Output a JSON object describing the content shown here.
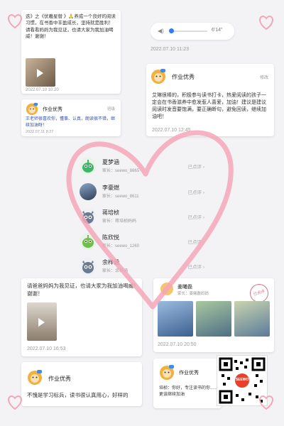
{
  "colors": {
    "accent": "#2f7cf6",
    "heart": "#f4a6b8",
    "card": "#ffffff",
    "muted": "#999999"
  },
  "top_left_post": {
    "text": "迭》之《伏羲星替 》🙏养成一个良好的阅读习惯，在书香中丰盈成长，坚持就是胜利！请看看妈妈为我见证，也请大家为我加油喝威！谢谢！",
    "timestamp": "2022.07.10 10:20"
  },
  "top_right_audio": {
    "duration": "6'14\"",
    "timestamp": "2022.07.10 11:23"
  },
  "left_excellent_card": {
    "title": "作业优秀",
    "badge": "班级",
    "text": "王老师很喜欢你，懂事、认真，朗读很不错，继续加油呀！",
    "timestamp": "2022.07.11 8:27"
  },
  "right_excellent_card": {
    "title": "作业优秀",
    "corner": "修改",
    "text": "艾琳很棒的，积极参与读书打卡，热爱阅读的孩子一定会在书香滋养中愈发惹人喜爱，加油！建议是建议阅读时发音要饱满，要正确断句，避免回读，继续加油吧！",
    "timestamp": "2022.07.10 12:45"
  },
  "students": [
    {
      "name": "夏梦涵",
      "parent": "家长：seewo_8865",
      "status": "已点评 ›",
      "avatar": "green-robot"
    },
    {
      "name": "李豪燃",
      "parent": "家长：seewo_8611",
      "status": "已点评 ›",
      "avatar": "photo"
    },
    {
      "name": "蒋培桢",
      "parent": "家长：蒋培桢妈妈",
      "status": "已点评 ›",
      "avatar": "grey-owl"
    },
    {
      "name": "陈欣悦",
      "parent": "家长：seewo_1260",
      "status": "已点评 ›",
      "avatar": "green-robot"
    },
    {
      "name": "余梓涵",
      "parent": "家长：余梓涵",
      "status": "已点评 ›",
      "avatar": "grey-owl"
    }
  ],
  "bottom_left_post": {
    "text": "请爸爸妈妈为我见证，也请大家为我加油喝威！谢谢！",
    "timestamp": "2022.07.10 16:53"
  },
  "bottom_right_post": {
    "name": "姜曦磊",
    "parent": "家长：姜曦磊妈妈",
    "timestamp": "2022.07.10 20:50",
    "stamp": "已点评"
  },
  "bottom_left_excellent": {
    "title": "作业优秀",
    "text": "不愧是学习标兵，读书很认真用心，好样的"
  },
  "bottom_right_excellent": {
    "title": "作业优秀",
    "text": "培桢：你好，专注读书的你……更该继续加油"
  },
  "qr": {
    "label": "SEEWO"
  }
}
